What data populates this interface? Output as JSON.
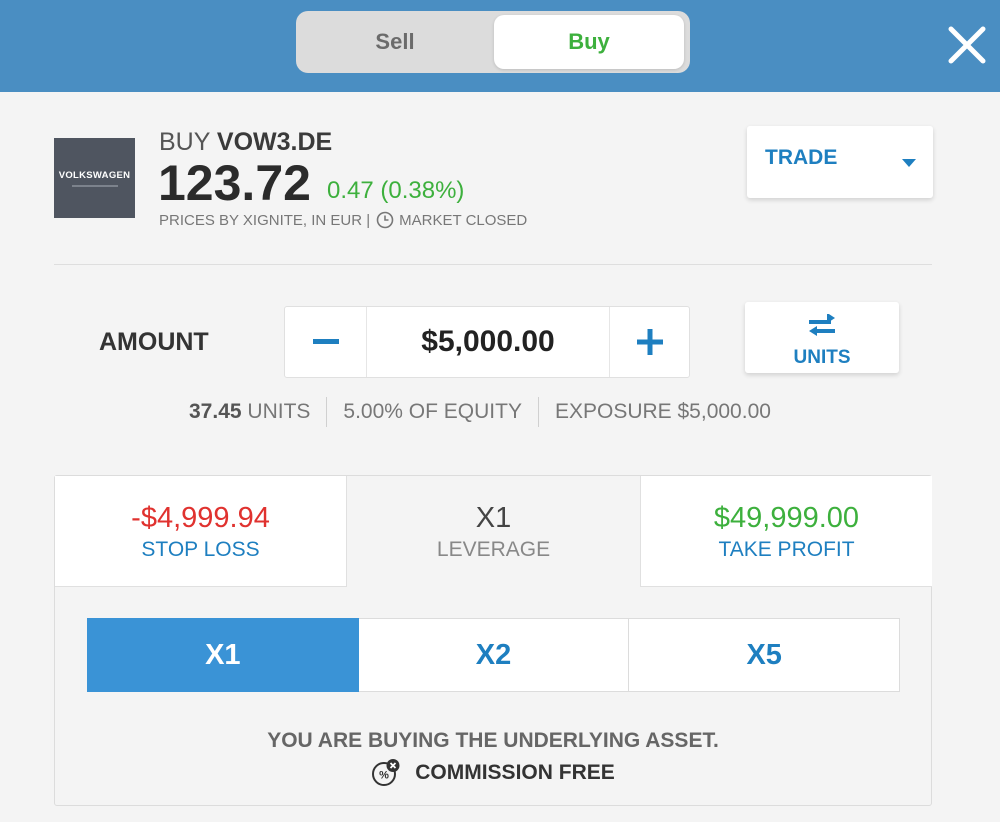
{
  "header": {
    "toggle": {
      "sell_label": "Sell",
      "buy_label": "Buy",
      "selected": "Buy"
    }
  },
  "asset": {
    "logo_text": "VOLKSWAGEN",
    "action": "BUY",
    "symbol": "VOW3.DE",
    "price": "123.72",
    "change": "0.47 (0.38%)",
    "prices_by": "PRICES BY XIGNITE, IN EUR |",
    "market_status": "MARKET CLOSED"
  },
  "trade_dropdown": {
    "label": "TRADE"
  },
  "amount": {
    "label": "AMOUNT",
    "value": "$5,000.00",
    "units_toggle_label": "UNITS"
  },
  "stats": {
    "units_value": "37.45",
    "units_label": "UNITS",
    "equity": "5.00% OF EQUITY",
    "exposure": "EXPOSURE $5,000.00"
  },
  "risk": {
    "stop_loss": {
      "value": "-$4,999.94",
      "label": "STOP LOSS"
    },
    "leverage": {
      "value": "X1",
      "label": "LEVERAGE"
    },
    "take_profit": {
      "value": "$49,999.00",
      "label": "TAKE PROFIT"
    }
  },
  "leverage_options": [
    {
      "label": "X1",
      "active": true
    },
    {
      "label": "X2",
      "active": false
    },
    {
      "label": "X5",
      "active": false
    }
  ],
  "footer": {
    "notice": "YOU ARE BUYING THE UNDERLYING ASSET.",
    "commission": "COMMISSION FREE"
  },
  "colors": {
    "header_bg": "#4a8ec2",
    "accent_blue": "#1e7fc0",
    "active_blue": "#3a93d6",
    "positive_green": "#3db03d",
    "negative_red": "#e0322f"
  }
}
